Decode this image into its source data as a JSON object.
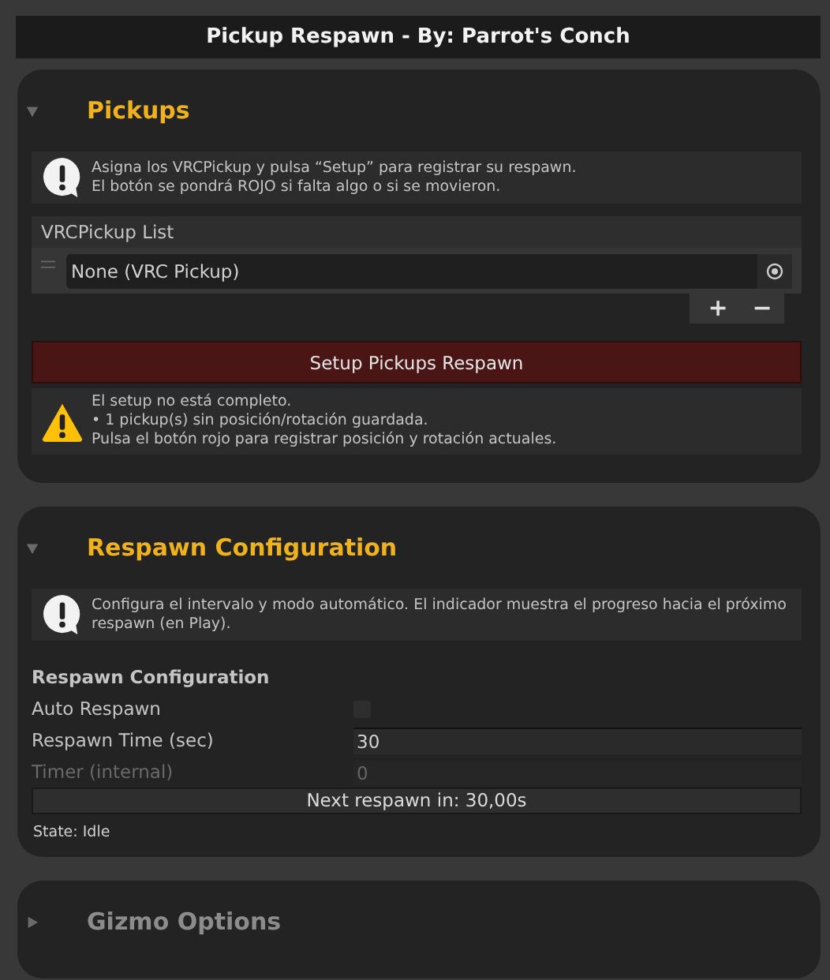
{
  "title": "Pickup Respawn - By: Parrot's Conch",
  "sections": [
    {
      "title": "Pickups",
      "expanded": true,
      "blocks": [
        {
          "kind": "info",
          "text": "Asigna los VRCPickup y pulsa “Setup” para registrar su respawn.\nEl botón se pondrá ROJO si falta algo o si se movieron."
        },
        {
          "kind": "list",
          "header": "VRCPickup List",
          "items": [
            {
              "value": "None (VRC Pickup)"
            }
          ],
          "add": "+",
          "remove": "−"
        },
        {
          "kind": "button",
          "label": "Setup Pickups Respawn",
          "alert": true
        },
        {
          "kind": "warning",
          "text": "El setup no está completo.\n• 1 pickup(s) sin posición/rotación guardada.\nPulsa el botón rojo para registrar posición y rotación actuales."
        }
      ]
    },
    {
      "title": "Respawn Configuration",
      "expanded": true,
      "blocks": [
        {
          "kind": "info",
          "text": "Configura el intervalo y modo automático. El indicador muestra el progreso hacia el próximo respawn (en Play)."
        },
        {
          "kind": "heading",
          "text": "Respawn Configuration"
        },
        {
          "kind": "checkbox",
          "label": "Auto Respawn",
          "checked": false
        },
        {
          "kind": "field",
          "label": "Respawn Time (sec)",
          "value": "30",
          "disabled": false
        },
        {
          "kind": "field",
          "label": "Timer (internal)",
          "value": "0",
          "disabled": true
        },
        {
          "kind": "bar",
          "text": "Next respawn in: 30,00s"
        },
        {
          "kind": "note",
          "text": "State: Idle"
        }
      ]
    },
    {
      "title": "Gizmo Options",
      "expanded": false
    }
  ]
}
